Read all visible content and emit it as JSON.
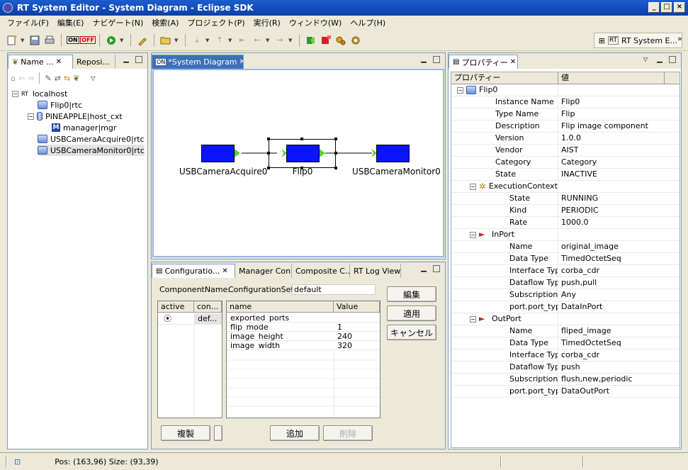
{
  "window": {
    "title": "RT System Editor - System Diagram - Eclipse SDK",
    "min": "_",
    "max": "□",
    "close": "×"
  },
  "menu": [
    "ファイル(F)",
    "編集(E)",
    "ナビゲート(N)",
    "検索(A)",
    "プロジェクト(P)",
    "実行(R)",
    "ウィンドウ(W)",
    "ヘルプ(H)"
  ],
  "toolbar": {
    "on": "ON",
    "off": "OFF"
  },
  "perspective": {
    "label": "RT System E...",
    "rt": "RT",
    "more": "»"
  },
  "name_panel": {
    "tabs": [
      "Name ...",
      "Reposi..."
    ],
    "tree": [
      {
        "label": "localhost",
        "icon": "rt-icon"
      },
      {
        "label": "Flip0|rtc",
        "icon": "rtc-icon"
      },
      {
        "label": "PINEAPPLE|host_cxt",
        "icon": "host-icon"
      },
      {
        "label": "manager|mgr",
        "icon": "manager-icon",
        "m": "M"
      },
      {
        "label": "USBCameraAcquire0|rtc",
        "icon": "rtc-icon"
      },
      {
        "label": "USBCameraMonitor0|rtc",
        "icon": "rtc-icon"
      }
    ],
    "rt_text": "RT"
  },
  "editor": {
    "tab": "*System Diagram",
    "components": [
      {
        "label": "USBCameraAcquire0"
      },
      {
        "label": "Flip0"
      },
      {
        "label": "USBCameraMonitor0"
      }
    ],
    "colors": {
      "component": "#0a14ff",
      "port": "#5ecf2f"
    }
  },
  "config_panel": {
    "tabs": [
      "Configuratio...",
      "Manager Con...",
      "Composite C...",
      "RT Log View"
    ],
    "component_name_label": "ComponentName:",
    "config_set_label": "ConfigurationSet:",
    "config_set_value": "default",
    "set_grid": {
      "headers": [
        "active",
        "con..."
      ],
      "rows": [
        {
          "active": "⦿",
          "name": "def..."
        }
      ]
    },
    "param_grid": {
      "headers": [
        "name",
        "Value"
      ],
      "rows": [
        {
          "name": "exported_ports",
          "value": ""
        },
        {
          "name": "flip_mode",
          "value": "1"
        },
        {
          "name": "image_height",
          "value": "240"
        },
        {
          "name": "image_width",
          "value": "320"
        }
      ]
    },
    "buttons": {
      "edit": "編集",
      "apply": "適用",
      "cancel": "キャンセル",
      "copy": "複製",
      "add": "追加",
      "delete": "削除"
    }
  },
  "properties": {
    "tab": "プロパティー",
    "headers": [
      "プロパティー",
      "値"
    ],
    "rows": [
      {
        "key": "Flip0",
        "value": "",
        "level": 0,
        "expand": "−",
        "icon": "rtc-icon"
      },
      {
        "key": "Instance Name",
        "value": "Flip0",
        "level": 2
      },
      {
        "key": "Type Name",
        "value": "Flip",
        "level": 2
      },
      {
        "key": "Description",
        "value": "Flip image component",
        "level": 2
      },
      {
        "key": "Version",
        "value": "1.0.0",
        "level": 2
      },
      {
        "key": "Vendor",
        "value": "AIST",
        "level": 2
      },
      {
        "key": "Category",
        "value": "Category",
        "level": 2
      },
      {
        "key": "State",
        "value": "INACTIVE",
        "level": 2
      },
      {
        "key": "ExecutionContext",
        "value": "",
        "level": 1,
        "expand": "−",
        "icon": "gear-icon"
      },
      {
        "key": "State",
        "value": "RUNNING",
        "level": 3
      },
      {
        "key": "Kind",
        "value": "PERIODIC",
        "level": 3
      },
      {
        "key": "Rate",
        "value": "1000.0",
        "level": 3
      },
      {
        "key": "InPort",
        "value": "",
        "level": 1,
        "expand": "−",
        "icon": "inport-icon"
      },
      {
        "key": "Name",
        "value": "original_image",
        "level": 3
      },
      {
        "key": "Data Type",
        "value": "TimedOctetSeq",
        "level": 3
      },
      {
        "key": "Interface Type",
        "value": "corba_cdr",
        "level": 3
      },
      {
        "key": "Dataflow Type",
        "value": "push,pull",
        "level": 3
      },
      {
        "key": "Subscription Type",
        "value": "Any",
        "level": 3
      },
      {
        "key": "port.port_type",
        "value": "DataInPort",
        "level": 3
      },
      {
        "key": "OutPort",
        "value": "",
        "level": 1,
        "expand": "−",
        "icon": "outport-icon"
      },
      {
        "key": "Name",
        "value": "fliped_image",
        "level": 3
      },
      {
        "key": "Data Type",
        "value": "TimedOctetSeq",
        "level": 3
      },
      {
        "key": "Interface Type",
        "value": "corba_cdr",
        "level": 3
      },
      {
        "key": "Dataflow Type",
        "value": "push",
        "level": 3
      },
      {
        "key": "Subscription Type",
        "value": "flush,new,periodic",
        "level": 3
      },
      {
        "key": "port.port_type",
        "value": "DataOutPort",
        "level": 3
      }
    ]
  },
  "status": {
    "text": "Pos: (163,96) Size: (93,39)"
  }
}
